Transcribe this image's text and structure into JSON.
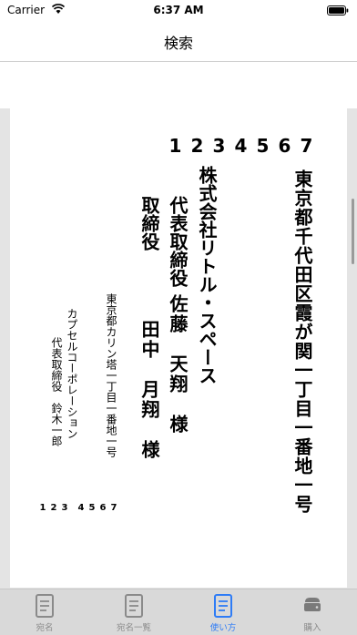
{
  "status_bar": {
    "carrier": "Carrier",
    "time": "6:37 AM"
  },
  "nav": {
    "title": "検索"
  },
  "card": {
    "postal_code_top": [
      "1",
      "2",
      "3",
      "4",
      "5",
      "6",
      "7"
    ],
    "address": "東京都千代田区霞が関一丁目一番地一号",
    "recipient_company": "株式会社リトル・スペース",
    "recipient_title": "代表取締役",
    "recipient_name": "佐藤　天翔　様",
    "recipient_title_2": "取締役",
    "recipient_name_2": "田中　月翔　様",
    "sender_address": "東京都カリン塔一丁目一番地一号",
    "sender_company": "カプセルコーポレーション",
    "sender_rep": "代表取締役　鈴木一郎",
    "postal_code_bottom": [
      "1",
      "2",
      "3",
      "4",
      "5",
      "6",
      "7"
    ]
  },
  "tabs": [
    {
      "label": "宛名",
      "icon": "document-icon",
      "active": false
    },
    {
      "label": "宛名一覧",
      "icon": "document-list-icon",
      "active": false
    },
    {
      "label": "使い方",
      "icon": "document-icon",
      "active": true
    },
    {
      "label": "購入",
      "icon": "storage-icon",
      "active": false
    }
  ],
  "colors": {
    "accent": "#2e7cf6",
    "inactive": "#8a8a8a",
    "tabbar": "#d9d9d9",
    "background": "#e4e4e4"
  }
}
